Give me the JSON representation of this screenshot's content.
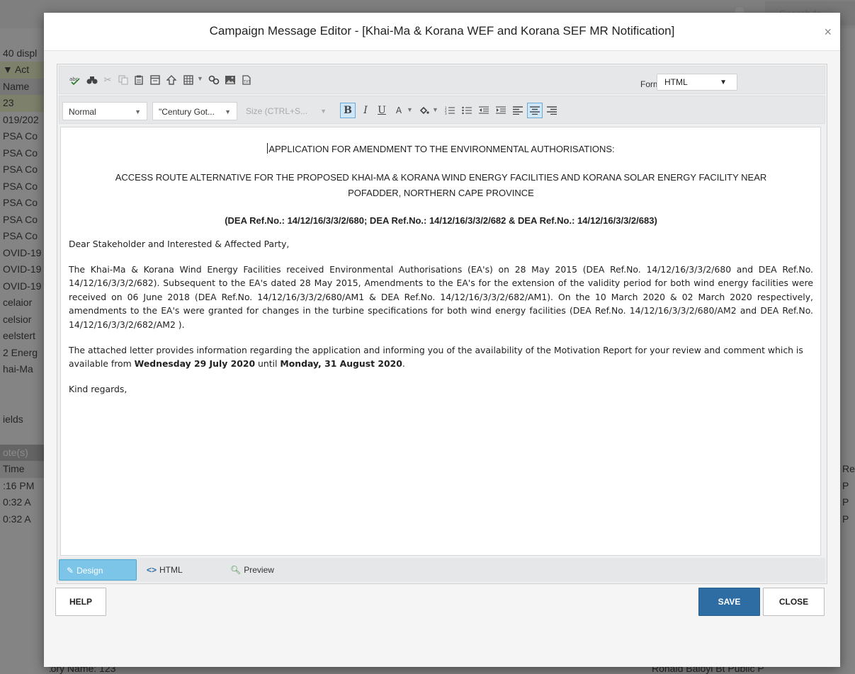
{
  "background": {
    "search_text": "Search fo",
    "left_rows": [
      "",
      "40 displ",
      "▼  Act",
      "Name",
      "23",
      "019/202",
      "PSA Co",
      "PSA Co",
      "PSA Co",
      "PSA Co",
      "PSA Co",
      "PSA Co",
      "PSA Co",
      "OVID-19",
      "OVID-19",
      "OVID-19",
      "celaior",
      "celsior",
      "eelstert",
      "2 Energ",
      "hai-Ma",
      "",
      "",
      "ields",
      "",
      "ote(s)",
      "Time",
      ":16 PM",
      " 0:32 A",
      " 0:32 A"
    ],
    "right_rows": [
      "",
      "",
      "",
      "",
      "",
      "",
      "",
      "",
      "",
      "",
      "",
      "",
      "",
      "",
      "",
      "",
      "",
      "",
      "",
      "",
      "",
      "",
      "",
      "",
      "",
      "",
      "Re",
      "P",
      "P",
      "P"
    ],
    "bottom_left": "0:32 AI   History   Name: 123",
    "bottom_right": "Ronald Baloyi Bt   Public   P"
  },
  "dialog": {
    "title": "Campaign Message Editor - [Khai-Ma & Korana WEF and Korana SEF MR Notification]",
    "close_glyph": "×",
    "toolbar": {
      "format_label": "Format:",
      "format_value": "HTML",
      "paragraph_style": "Normal",
      "font_family": "\"Century Got...",
      "font_size": "Size (CTRL+S..."
    },
    "content": {
      "heading1": "APPLICATION FOR AMENDMENT TO THE ENVIRONMENTAL AUTHORISATIONS:",
      "heading2": "ACCESS ROUTE ALTERNATIVE FOR THE PROPOSED KHAI-MA & KORANA WIND ENERGY FACILITIES AND KORANA SOLAR ENERGY FACILITY NEAR POFADDER, NORTHERN CAPE PROVINCE",
      "heading3": "(DEA Ref.No.: 14/12/16/3/3/2/680; DEA Ref.No.: 14/12/16/3/3/2/682 & DEA Ref.No.: 14/12/16/3/3/2/683)",
      "greeting": "Dear Stakeholder and Interested & Affected Party,",
      "para1": "The Khai-Ma & Korana Wind Energy Facilities received Environmental Authorisations (EA's) on 28 May 2015 (DEA Ref.No. 14/12/16/3/3/2/680 and DEA Ref.No. 14/12/16/3/3/2/682). Subsequent to the EA's dated 28 May 2015, Amendments to the EA's for the extension of the validity period for both wind energy facilities were received on 06 June 2018 (DEA Ref.No. 14/12/16/3/3/2/680/AM1 & DEA Ref.No. 14/12/16/3/3/2/682/AM1). On the 10 March 2020 & 02 March 2020 respectively, amendments to the EA's were granted for changes in the turbine specifications for both wind energy facilities (DEA Ref.No. 14/12/16/3/3/2/680/AM2 and DEA Ref.No. 14/12/16/3/3/2/682/AM2 ).",
      "para2_start": "The attached letter provides information regarding the application and informing you of the availability of the Motivation Report for your review and comment which is available from ",
      "para2_date1": "Wednesday 29 July 2020",
      "para2_mid": " until ",
      "para2_date2": "Monday, 31 August 2020",
      "para2_end": ".",
      "closing": "Kind regards,"
    },
    "modes": {
      "design": "Design",
      "html": "HTML",
      "preview": "Preview"
    },
    "buttons": {
      "help": "HELP",
      "save": "SAVE",
      "close": "CLOSE"
    }
  },
  "colors": {
    "accent_blue": "#2e6da4",
    "active_tab": "#7cc5e8",
    "row_highlight": "#e3eac4"
  }
}
